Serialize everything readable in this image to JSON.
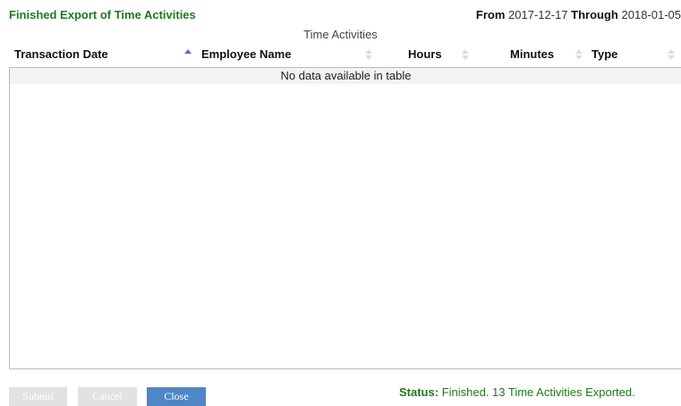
{
  "header": {
    "title": "Finished Export of Time Activities",
    "from_label": "From",
    "from_date": "2017-12-17",
    "through_label": "Through",
    "through_date": "2018-01-05"
  },
  "table": {
    "caption": "Time Activities",
    "columns": [
      {
        "label": "Transaction Date",
        "sort": "ascending"
      },
      {
        "label": "Employee Name",
        "sort": "none"
      },
      {
        "label": "Hours",
        "sort": "none"
      },
      {
        "label": "Minutes",
        "sort": "none"
      },
      {
        "label": "Type",
        "sort": "none"
      }
    ],
    "empty_message": "No data available in table"
  },
  "buttons": {
    "submit": "Submit",
    "cancel": "Cancel",
    "close": "Close"
  },
  "status": {
    "label": "Status:",
    "text": "Finished. 13 Time Activities Exported."
  },
  "colors": {
    "title_green": "#1e7a1e",
    "close_button": "#4f86c6",
    "disabled_button": "#e2e2e2",
    "sort_active": "#5b6fd0"
  }
}
